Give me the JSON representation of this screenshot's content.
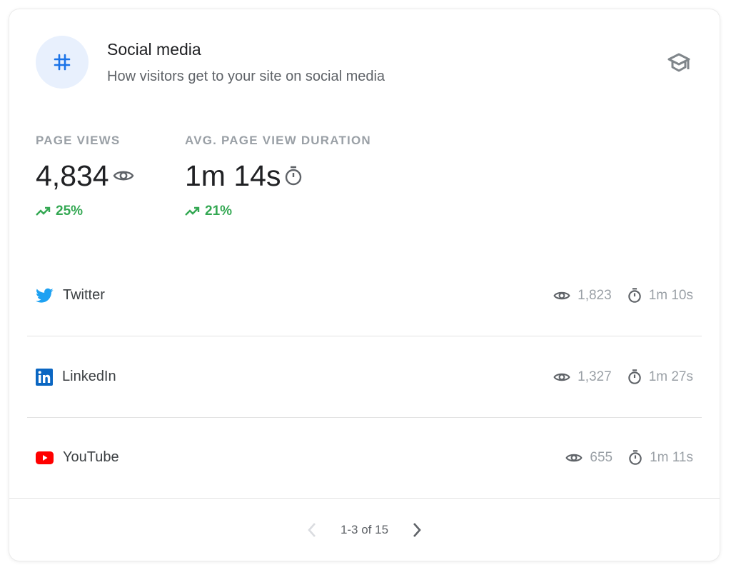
{
  "header": {
    "icon": "hashtag-icon",
    "title": "Social media",
    "subtitle": "How visitors get to your site on social media",
    "learn_icon": "graduation-cap-icon"
  },
  "metrics": [
    {
      "label": "PAGE VIEWS",
      "value": "4,834",
      "icon": "eye-icon",
      "change": "25%",
      "trend": "up"
    },
    {
      "label": "AVG. PAGE VIEW DURATION",
      "value": "1m 14s",
      "icon": "stopwatch-icon",
      "change": "21%",
      "trend": "up"
    }
  ],
  "sources": [
    {
      "name": "Twitter",
      "icon": "twitter-icon",
      "views": "1,823",
      "duration": "1m 10s"
    },
    {
      "name": "LinkedIn",
      "icon": "linkedin-icon",
      "views": "1,327",
      "duration": "1m 27s"
    },
    {
      "name": "YouTube",
      "icon": "youtube-icon",
      "views": "655",
      "duration": "1m 11s"
    }
  ],
  "pagination": {
    "label": "1-3 of 15",
    "prev_enabled": false,
    "next_enabled": true
  },
  "colors": {
    "accent": "#1a73e8",
    "positive": "#34a853",
    "twitter": "#1da1f2",
    "linkedin": "#0a66c2",
    "youtube": "#ff0000"
  }
}
